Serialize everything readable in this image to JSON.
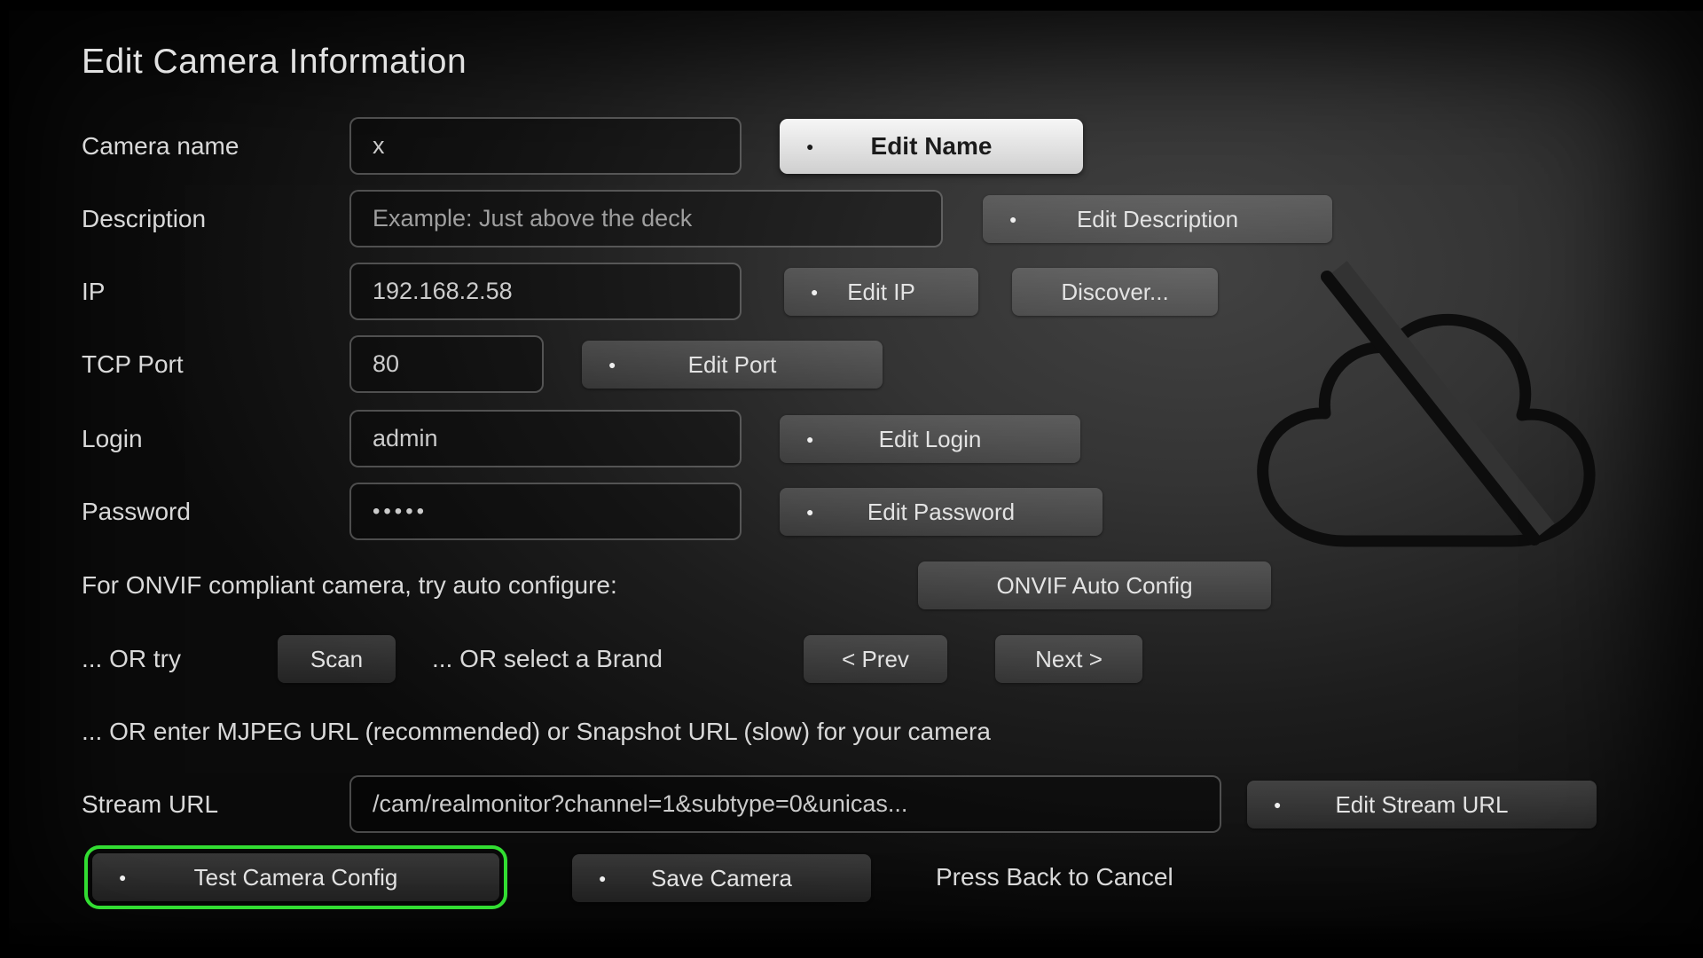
{
  "title": "Edit Camera Information",
  "form": {
    "camera_name": {
      "label": "Camera name",
      "value": "x",
      "edit_button": "Edit Name"
    },
    "description": {
      "label": "Description",
      "placeholder": "Example: Just above the deck",
      "edit_button": "Edit Description"
    },
    "ip": {
      "label": "IP",
      "value": "192.168.2.58",
      "edit_button": "Edit IP",
      "discover_button": "Discover..."
    },
    "tcp_port": {
      "label": "TCP Port",
      "value": "80",
      "edit_button": "Edit Port"
    },
    "login": {
      "label": "Login",
      "value": "admin",
      "edit_button": "Edit Login"
    },
    "password": {
      "label": "Password",
      "value": "•••••",
      "edit_button": "Edit Password"
    },
    "stream_url": {
      "label": "Stream URL",
      "value": "/cam/realmonitor?channel=1&subtype=0&unicas...",
      "edit_button": "Edit Stream URL"
    }
  },
  "onvif_row": {
    "text": "For ONVIF compliant camera, try auto configure:",
    "button": "ONVIF Auto Config"
  },
  "alternatives_row": {
    "or_try_text": "... OR try",
    "scan_button": "Scan",
    "or_brand_text": "... OR select a Brand",
    "prev_button": "< Prev",
    "next_button": "Next >"
  },
  "url_hint": "... OR enter MJPEG URL (recommended) or Snapshot URL (slow) for your camera",
  "footer": {
    "test_button": "Test Camera Config",
    "save_button": "Save Camera",
    "cancel_text": "Press Back to Cancel"
  },
  "icons": {
    "bullet_glyph": "●",
    "cloud_off": "cloud-off-icon"
  },
  "colors": {
    "focus_annotation_green": "#32dd32",
    "focused_button_bg": "#efefef",
    "button_text": "#e3e3e3",
    "page_background": "#343434"
  }
}
